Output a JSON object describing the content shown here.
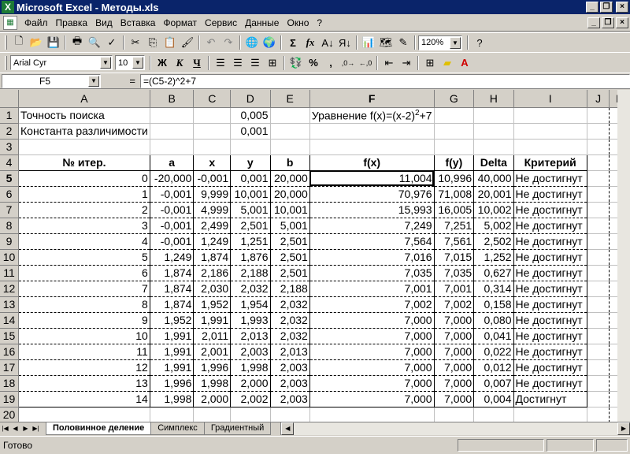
{
  "window": {
    "title": "Microsoft Excel - Методы.xls",
    "app_icon": "X",
    "controls": [
      "_",
      "❐",
      "×"
    ]
  },
  "menu": {
    "items": [
      "Файл",
      "Правка",
      "Вид",
      "Вставка",
      "Формат",
      "Сервис",
      "Данные",
      "Окно",
      "?"
    ]
  },
  "toolbar": {
    "zoom": "120%",
    "font_name": "Arial Cyr",
    "font_size": "10",
    "bold": "Ж",
    "italic": "К",
    "underline": "Ч",
    "sigma": "Σ",
    "fx": "fx",
    "percent": "%",
    "comma": ","
  },
  "formula_bar": {
    "name_box": "F5",
    "eq": "=",
    "formula": "=(C5-2)^2+7"
  },
  "columns": [
    "A",
    "B",
    "C",
    "D",
    "E",
    "F",
    "G",
    "H",
    "I",
    "J",
    "K"
  ],
  "rows_header": [
    "1",
    "2",
    "3",
    "4",
    "5",
    "6",
    "7",
    "8",
    "9",
    "10",
    "11",
    "12",
    "13",
    "14",
    "15",
    "16",
    "17",
    "18",
    "19",
    "20"
  ],
  "cells": {
    "a1": "Точность поиска",
    "d1": "0,005",
    "f1": "Уравнение f(x)=(x-2)",
    "f1_sup": "2",
    "f1_tail": "+7",
    "a2": "Константа различимости",
    "d2": "0,001",
    "headers": [
      "№ итер.",
      "a",
      "x",
      "y",
      "b",
      "f(x)",
      "f(y)",
      "Delta",
      "Критерий"
    ]
  },
  "table": [
    [
      "0",
      "-20,000",
      "-0,001",
      "0,001",
      "20,000",
      "11,004",
      "10,996",
      "40,000",
      "Не достигнут"
    ],
    [
      "1",
      "-0,001",
      "9,999",
      "10,001",
      "20,000",
      "70,976",
      "71,008",
      "20,001",
      "Не достигнут"
    ],
    [
      "2",
      "-0,001",
      "4,999",
      "5,001",
      "10,001",
      "15,993",
      "16,005",
      "10,002",
      "Не достигнут"
    ],
    [
      "3",
      "-0,001",
      "2,499",
      "2,501",
      "5,001",
      "7,249",
      "7,251",
      "5,002",
      "Не достигнут"
    ],
    [
      "4",
      "-0,001",
      "1,249",
      "1,251",
      "2,501",
      "7,564",
      "7,561",
      "2,502",
      "Не достигнут"
    ],
    [
      "5",
      "1,249",
      "1,874",
      "1,876",
      "2,501",
      "7,016",
      "7,015",
      "1,252",
      "Не достигнут"
    ],
    [
      "6",
      "1,874",
      "2,186",
      "2,188",
      "2,501",
      "7,035",
      "7,035",
      "0,627",
      "Не достигнут"
    ],
    [
      "7",
      "1,874",
      "2,030",
      "2,032",
      "2,188",
      "7,001",
      "7,001",
      "0,314",
      "Не достигнут"
    ],
    [
      "8",
      "1,874",
      "1,952",
      "1,954",
      "2,032",
      "7,002",
      "7,002",
      "0,158",
      "Не достигнут"
    ],
    [
      "9",
      "1,952",
      "1,991",
      "1,993",
      "2,032",
      "7,000",
      "7,000",
      "0,080",
      "Не достигнут"
    ],
    [
      "10",
      "1,991",
      "2,011",
      "2,013",
      "2,032",
      "7,000",
      "7,000",
      "0,041",
      "Не достигнут"
    ],
    [
      "11",
      "1,991",
      "2,001",
      "2,003",
      "2,013",
      "7,000",
      "7,000",
      "0,022",
      "Не достигнут"
    ],
    [
      "12",
      "1,991",
      "1,996",
      "1,998",
      "2,003",
      "7,000",
      "7,000",
      "0,012",
      "Не достигнут"
    ],
    [
      "13",
      "1,996",
      "1,998",
      "2,000",
      "2,003",
      "7,000",
      "7,000",
      "0,007",
      "Не достигнут"
    ],
    [
      "14",
      "1,998",
      "2,000",
      "2,002",
      "2,003",
      "7,000",
      "7,000",
      "0,004",
      "Достигнут"
    ]
  ],
  "tabs": [
    "Половинное деление",
    "Симплекс",
    "Градиентный"
  ],
  "status": {
    "text": "Готово"
  }
}
